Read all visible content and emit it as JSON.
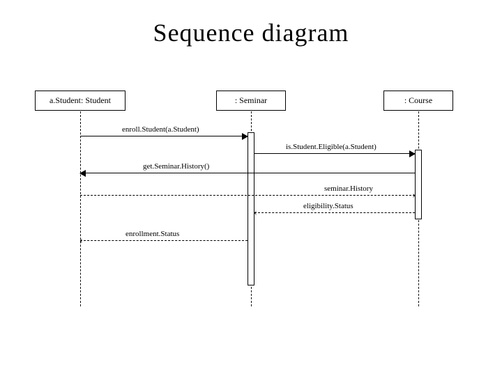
{
  "title": "Sequence diagram",
  "lifelines": {
    "student": "a.Student: Student",
    "seminar": ": Seminar",
    "course": ": Course"
  },
  "messages": {
    "m1": "enroll.Student(a.Student)",
    "m2": "is.Student.Eligible(a.Student)",
    "m3": "get.Seminar.History()",
    "m4": "seminar.History",
    "m5": "eligibility.Status",
    "m6": "enrollment.Status"
  }
}
